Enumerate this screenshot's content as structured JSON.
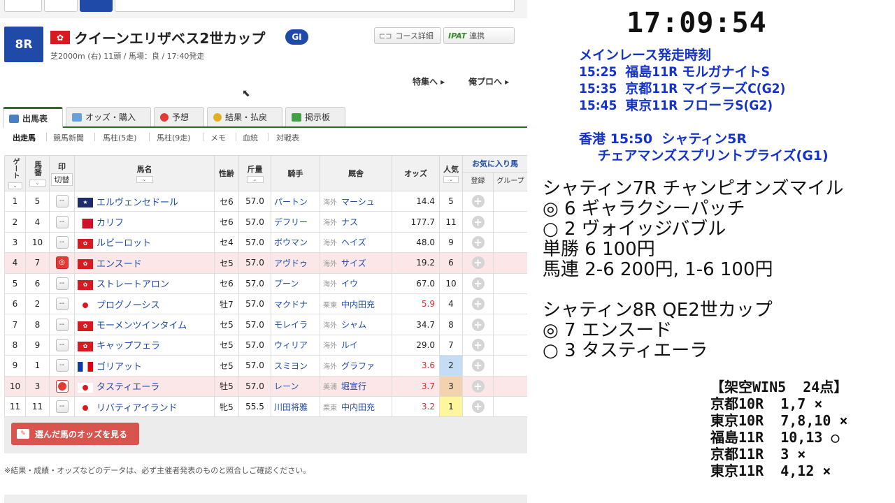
{
  "race": {
    "number": "8R",
    "title": "クイーンエリザベス2世カップ",
    "grade": "GI",
    "info": "芝2000m (右) 11頭 / 馬場：良 / 17:40発走",
    "course_btn": "コース詳細",
    "ipat_logo": "IPAT",
    "ipat_btn": "連携",
    "link_tokushu": "特集へ ▸",
    "link_oreno": "俺プロへ ▸"
  },
  "tabs": [
    {
      "label": "出馬表",
      "color": "#4a7fc1"
    },
    {
      "label": "オッズ・購入",
      "color": "#6aa0d8"
    },
    {
      "label": "予想",
      "color": "#e53935"
    },
    {
      "label": "結果・払戻",
      "color": "#e0b020"
    },
    {
      "label": "掲示板",
      "color": "#43a047"
    }
  ],
  "subtabs": [
    "出走馬",
    "競馬新聞",
    "馬柱(5走)",
    "馬柱(9走)",
    "メモ",
    "血統",
    "対戦表"
  ],
  "table": {
    "headers": {
      "gate": "ゲート",
      "num": "馬番",
      "mark": "印",
      "mark_sub": "切替",
      "horse": "馬名",
      "sex_age": "性齢",
      "weight": "斤量",
      "jockey": "騎手",
      "trainer": "厩舎",
      "odds": "オッズ",
      "pop": "人気",
      "fav": "お気に入り馬",
      "fav_reg": "登録",
      "fav_group": "グループ"
    },
    "rows": [
      {
        "gate": "1",
        "num": "5",
        "mark": "--",
        "flag": "nz",
        "horse": "エルヴェンセドール",
        "sex_age": "セ6",
        "weight": "57.0",
        "jockey": "パートン",
        "region": "海外",
        "trainer": "マーシュ",
        "odds": "14.4",
        "pop": "5"
      },
      {
        "gate": "2",
        "num": "4",
        "mark": "--",
        "flag": "bh",
        "horse": "カリフ",
        "sex_age": "セ6",
        "weight": "57.0",
        "jockey": "デフリー",
        "region": "海外",
        "trainer": "ナス",
        "odds": "177.7",
        "pop": "11"
      },
      {
        "gate": "3",
        "num": "10",
        "mark": "--",
        "flag": "hk",
        "horse": "ルビーロット",
        "sex_age": "セ4",
        "weight": "57.0",
        "jockey": "ボウマン",
        "region": "海外",
        "trainer": "ヘイズ",
        "odds": "48.0",
        "pop": "9"
      },
      {
        "gate": "4",
        "num": "7",
        "mark": "◎",
        "flag": "hk",
        "horse": "エンスード",
        "sex_age": "セ5",
        "weight": "57.0",
        "jockey": "アヴドゥ",
        "region": "海外",
        "trainer": "サイズ",
        "odds": "19.2",
        "pop": "6"
      },
      {
        "gate": "5",
        "num": "6",
        "mark": "--",
        "flag": "hk",
        "horse": "ストレートアロン",
        "sex_age": "セ6",
        "weight": "57.0",
        "jockey": "プーン",
        "region": "海外",
        "trainer": "イウ",
        "odds": "67.0",
        "pop": "10"
      },
      {
        "gate": "6",
        "num": "2",
        "mark": "--",
        "flag": "jp",
        "horse": "プログノーシス",
        "sex_age": "牡7",
        "weight": "57.0",
        "jockey": "マクドナ",
        "region": "栗東",
        "trainer": "中内田充",
        "odds": "5.9",
        "pop": "4"
      },
      {
        "gate": "7",
        "num": "8",
        "mark": "--",
        "flag": "hk",
        "horse": "モーメンツインタイム",
        "sex_age": "セ5",
        "weight": "57.0",
        "jockey": "モレイラ",
        "region": "海外",
        "trainer": "シャム",
        "odds": "34.7",
        "pop": "8"
      },
      {
        "gate": "8",
        "num": "9",
        "mark": "--",
        "flag": "hk",
        "horse": "キャップフェラ",
        "sex_age": "セ5",
        "weight": "57.0",
        "jockey": "ウィリア",
        "region": "海外",
        "trainer": "ルイ",
        "odds": "29.0",
        "pop": "7"
      },
      {
        "gate": "9",
        "num": "1",
        "mark": "--",
        "flag": "fr",
        "horse": "ゴリアット",
        "sex_age": "セ5",
        "weight": "57.0",
        "jockey": "スミヨン",
        "region": "海外",
        "trainer": "グラファ",
        "odds": "3.6",
        "pop": "2"
      },
      {
        "gate": "10",
        "num": "3",
        "mark": "○",
        "flag": "jp",
        "horse": "タスティエーラ",
        "sex_age": "牡5",
        "weight": "57.0",
        "jockey": "レーン",
        "region": "美浦",
        "trainer": "堀宣行",
        "odds": "3.7",
        "pop": "3"
      },
      {
        "gate": "11",
        "num": "11",
        "mark": "--",
        "flag": "jp",
        "horse": "リバティアイランド",
        "sex_age": "牝5",
        "weight": "55.5",
        "jockey": "川田将雅",
        "region": "栗東",
        "trainer": "中内田充",
        "odds": "3.2",
        "pop": "1"
      }
    ]
  },
  "odds_button": "選んだ馬のオッズを見る",
  "disclaimer": "※結果・成績・オッズなどのデータは、必ず主催者発表のものと照合しご確認ください。",
  "overlay": {
    "clock": "17:09:54",
    "main_races": "メインレース発走時刻\n15:25  福島11R モルガナイトS\n15:35  京都11R マイラーズC(G2)\n15:45  東京11R フローラS(G2)",
    "hk_races": "香港 15:50  シャティン5R\n    チェアマンズスプリントプライズ(G1)",
    "pick7": "シャティン7R チャンピオンズマイル\n◎ 6 ギャラクシーパッチ\n○ 2 ヴォイッジバブル\n単勝 6 100円\n馬連 2-6 200円, 1-6 100円",
    "pick8": "シャティン8R QE2世カップ\n◎ 7 エンスード\n○ 3 タスティエーラ",
    "win5": "【架空WIN5  24点】\n京都10R  1,7 ×\n東京10R  7,8,10 ×\n福島11R  10,13 ○\n京都11R  3 ×\n東京11R  4,12 ×"
  }
}
